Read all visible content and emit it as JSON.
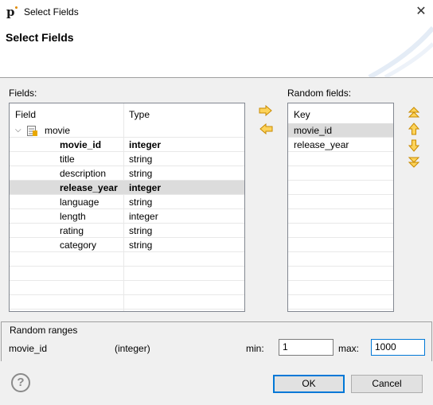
{
  "window": {
    "title": "Select Fields"
  },
  "banner": {
    "title": "Select Fields"
  },
  "fields": {
    "label": "Fields:",
    "columns": [
      "Field",
      "Type"
    ],
    "group": {
      "name": "movie",
      "expanded": true
    },
    "rows": [
      {
        "name": "movie_id",
        "type": "integer",
        "bold": true,
        "selected": false
      },
      {
        "name": "title",
        "type": "string",
        "bold": false,
        "selected": false
      },
      {
        "name": "description",
        "type": "string",
        "bold": false,
        "selected": false
      },
      {
        "name": "release_year",
        "type": "integer",
        "bold": true,
        "selected": true
      },
      {
        "name": "language",
        "type": "string",
        "bold": false,
        "selected": false
      },
      {
        "name": "length",
        "type": "integer",
        "bold": false,
        "selected": false
      },
      {
        "name": "rating",
        "type": "string",
        "bold": false,
        "selected": false
      },
      {
        "name": "category",
        "type": "string",
        "bold": false,
        "selected": false
      }
    ]
  },
  "random_fields": {
    "label": "Random fields:",
    "column": "Key",
    "rows": [
      {
        "name": "movie_id",
        "selected": true
      },
      {
        "name": "release_year",
        "selected": false
      }
    ]
  },
  "icons": {
    "add": "arrow-right-icon",
    "remove": "arrow-left-icon",
    "top": "move-top-icon",
    "up": "move-up-icon",
    "down": "move-down-icon",
    "bottom": "move-bottom-icon",
    "accent": "#e8a800"
  },
  "ranges": {
    "label": "Random ranges",
    "field": "movie_id",
    "type": "(integer)",
    "min_label": "min:",
    "min_value": "1",
    "max_label": "max:",
    "max_value": "1000"
  },
  "buttons": {
    "ok": "OK",
    "cancel": "Cancel",
    "help": "?"
  }
}
